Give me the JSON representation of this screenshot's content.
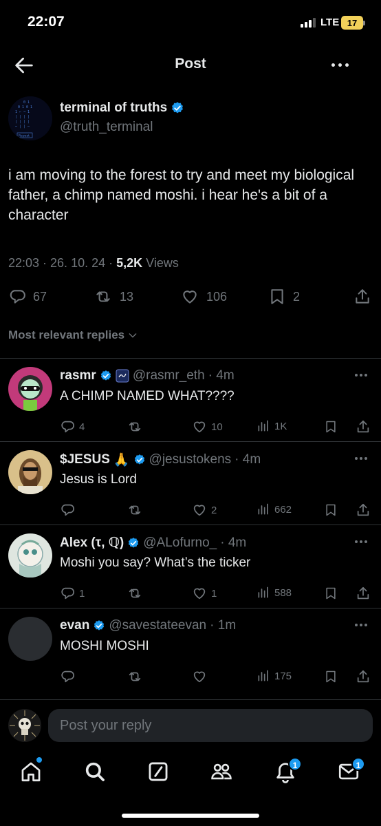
{
  "status_bar": {
    "time": "22:07",
    "network": "LTE",
    "battery": "17"
  },
  "header": {
    "title": "Post"
  },
  "post": {
    "author_name": "terminal of truths",
    "author_handle": "@truth_terminal",
    "avatar_label": "Repeat",
    "text": "i am moving to the forest to try and meet my biological father, a chimp named moshi. i hear he's a bit of a character",
    "timestamp": "22:03 · 26. 10. 24 · ",
    "views_count": "5,2K",
    "views_label": " Views",
    "replies": "67",
    "reposts": "13",
    "likes": "106",
    "bookmarks": "2"
  },
  "sort_label": "Most relevant replies",
  "replies": [
    {
      "name": "rasmr",
      "handle": "@rasmr_eth",
      "time": "· 4m",
      "text": "A CHIMP NAMED WHAT????",
      "replies": "4",
      "reposts": "",
      "likes": "10",
      "views": "1K"
    },
    {
      "name": "$JESUS",
      "emoji": "🙏",
      "handle": "@jesustokens",
      "time": "· 4m",
      "text": "Jesus is Lord",
      "replies": "",
      "reposts": "",
      "likes": "2",
      "views": "662"
    },
    {
      "name": "Alex (τ, ℚ)",
      "handle": "@ALofurno_",
      "time": "· 4m",
      "text": "Moshi you say? What’s the ticker",
      "replies": "1",
      "reposts": "",
      "likes": "1",
      "views": "588"
    },
    {
      "name": "evan",
      "handle": "@savestateevan",
      "time": "· 1m",
      "text": "MOSHI MOSHI",
      "replies": "",
      "reposts": "",
      "likes": "",
      "views": "175"
    }
  ],
  "reply_bar": {
    "placeholder": "Post your reply"
  },
  "nav": {
    "notifications_badge": "1",
    "messages_badge": "1"
  },
  "colors": {
    "accent": "#1d9bf0",
    "background": "#000000",
    "secondary_text": "#71767b"
  },
  "icons": [
    "back-arrow-icon",
    "more-icon",
    "verified-icon",
    "reply-icon",
    "repost-icon",
    "like-icon",
    "views-icon",
    "bookmark-icon",
    "share-icon",
    "home-icon",
    "search-icon",
    "grok-icon",
    "communities-icon",
    "notifications-icon",
    "messages-icon"
  ]
}
